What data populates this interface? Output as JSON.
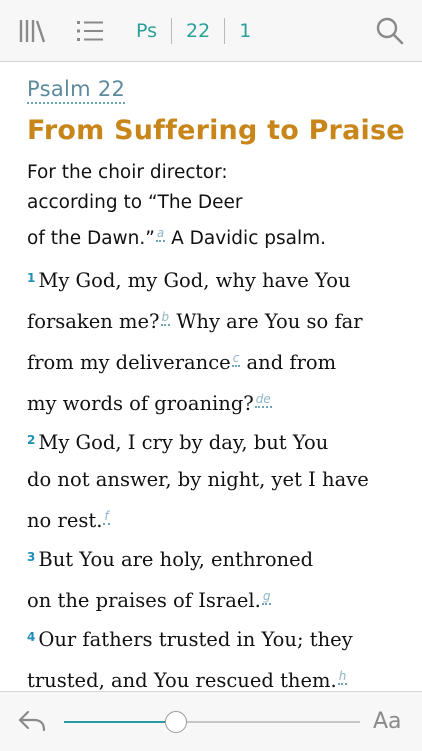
{
  "toolbar": {
    "library_icon": "library-icon",
    "contents_icon": "list-icon",
    "book": "Ps",
    "chapter": "22",
    "verse": "1",
    "search_icon": "search-icon"
  },
  "content": {
    "psalm_ref": "Psalm 22",
    "heading": "From Suffering to Praise",
    "superscription": {
      "line1": "For the choir director:",
      "line2": "according to “The Deer",
      "line3a": "of the Dawn.”",
      "fn_a": "a",
      "line3b": " A Davidic  psalm."
    },
    "verses": {
      "v1": {
        "num": "1",
        "t1": "My God, my God, why have You",
        "t2": "forsaken me?",
        "fn_b": "b",
        "t3": " Why are You so far",
        "t4": "from  my deliverance",
        "fn_c": "c",
        "t5": " and from",
        "t6": "my words of groaning?",
        "fn_de": "de"
      },
      "v2": {
        "num": "2",
        "t1": "My God, I cry by day, but You",
        "t2": "do not  answer, by night, yet I have",
        "t3": "no  rest.",
        "fn_f": "f"
      },
      "v3": {
        "num": "3",
        "t1": "But You are holy, enthroned",
        "t2": "on the praises of Israel.",
        "fn_g": "g"
      },
      "v4": {
        "num": "4",
        "t1": "Our fathers trusted in You; they",
        "t2": "trusted, and You rescued them.",
        "fn_h": "h"
      }
    }
  },
  "bottombar": {
    "back_icon": "back-arrow-icon",
    "slider_progress": 0.38,
    "font_size_label": "Aa"
  },
  "colors": {
    "accent": "#2aa198",
    "heading": "#c8861a",
    "psalm_ref": "#5d8b9c",
    "verse_number": "#1f8fb5"
  }
}
